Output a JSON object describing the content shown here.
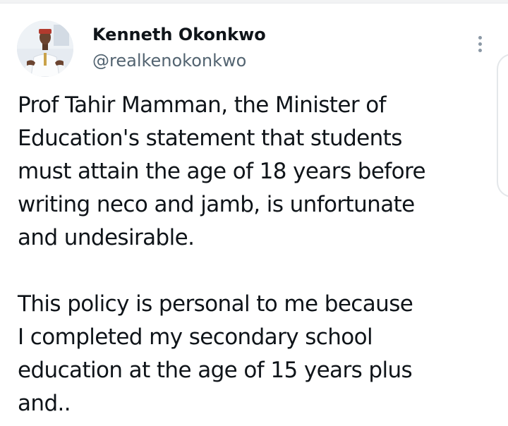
{
  "author": {
    "display_name": "Kenneth Okonkwo",
    "handle": "@realkenokonkwo",
    "avatar_icon": "profile-photo"
  },
  "tweet": {
    "paragraph1": [
      "Prof Tahir Mamman, the Minister of",
      "Education's statement that students",
      "must attain the age of 18 years before",
      "writing neco and jamb, is unfortunate",
      "and undesirable."
    ],
    "paragraph2": [
      "This policy is personal to me because",
      "I completed my secondary school",
      "education at the age of 15 years plus",
      "and.."
    ]
  },
  "more_icon": "more-vertical-icon",
  "colors": {
    "text": "#0f1419",
    "secondary": "#536471",
    "icon": "#8b98a5"
  }
}
